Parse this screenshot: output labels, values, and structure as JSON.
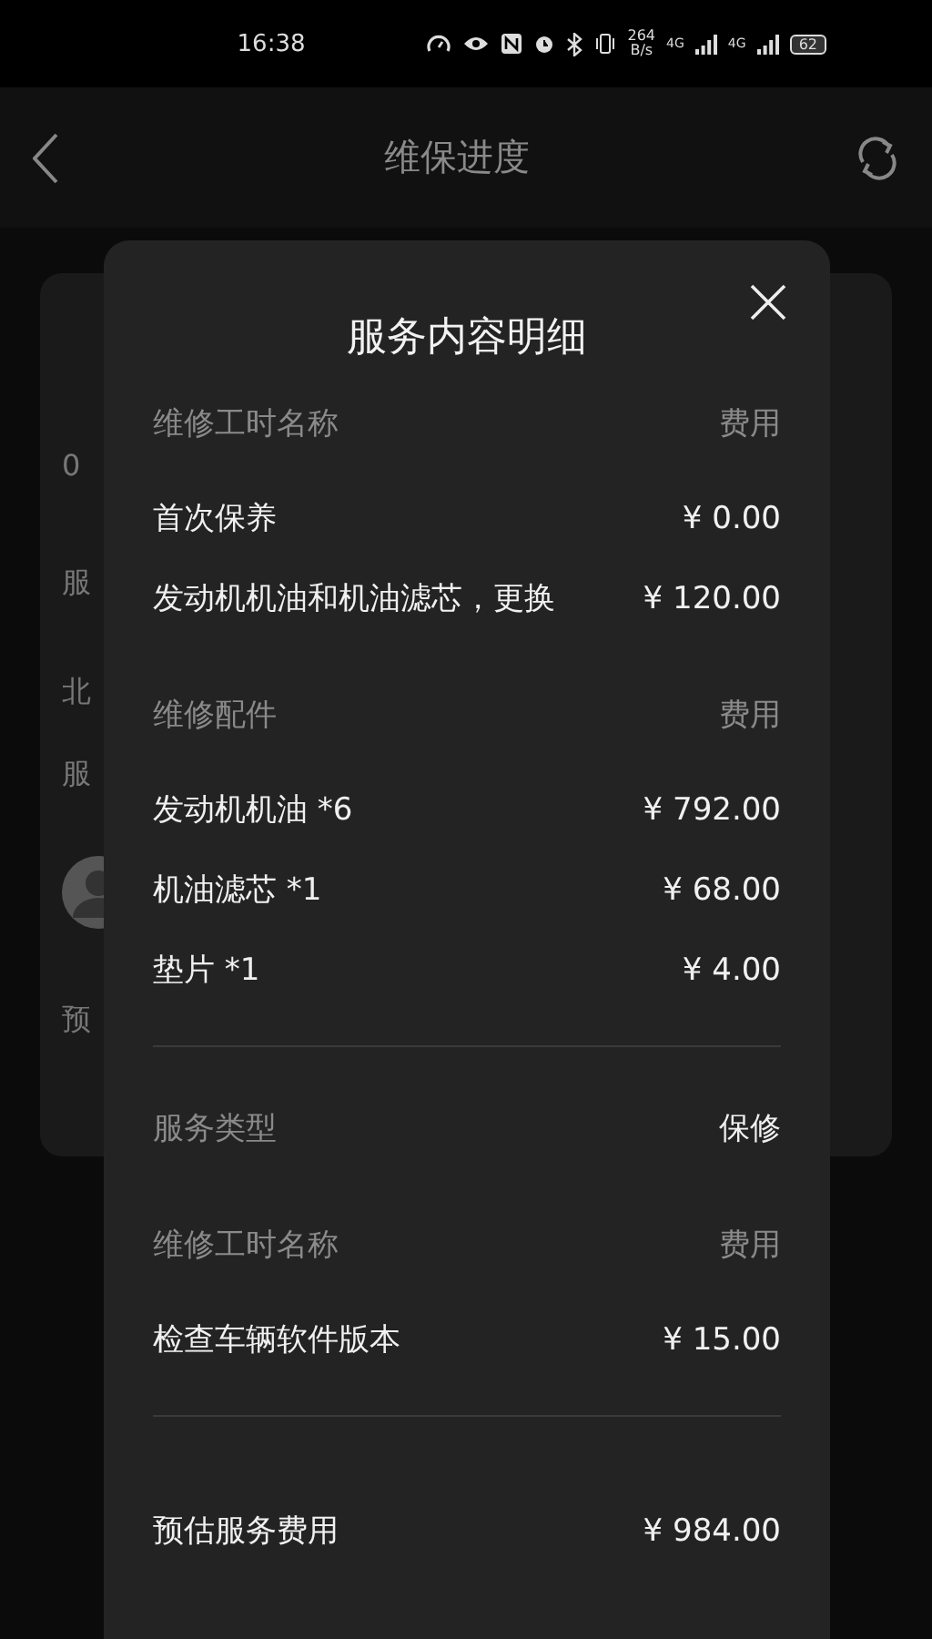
{
  "status_bar": {
    "time": "16:38",
    "speed": "264",
    "speed_unit": "B/s",
    "networks": [
      "4G",
      "4G"
    ],
    "battery": "62"
  },
  "header": {
    "title": "维保进度"
  },
  "background_card": {
    "texts": [
      "0",
      "服",
      "北",
      "服",
      "预"
    ]
  },
  "dialog": {
    "title": "服务内容明细",
    "sections": [
      {
        "kind": "table",
        "name_header": "维修工时名称",
        "fee_header": "费用",
        "items": [
          {
            "name": "首次保养",
            "fee": "¥ 0.00"
          },
          {
            "name": "发动机机油和机油滤芯，更换",
            "fee": "¥ 120.00"
          }
        ]
      },
      {
        "kind": "table",
        "name_header": "维修配件",
        "fee_header": "费用",
        "items": [
          {
            "name": "发动机机油 *6",
            "fee": "¥ 792.00"
          },
          {
            "name": "机油滤芯 *1",
            "fee": "¥ 68.00"
          },
          {
            "name": "垫片 *1",
            "fee": "¥ 4.00"
          }
        ]
      },
      {
        "kind": "pair",
        "label": "服务类型",
        "value": "保修"
      },
      {
        "kind": "table",
        "name_header": "维修工时名称",
        "fee_header": "费用",
        "items": [
          {
            "name": "检查车辆软件版本",
            "fee": "¥ 15.00"
          }
        ]
      },
      {
        "kind": "total",
        "label": "预估服务费用",
        "value": "¥ 984.00"
      }
    ]
  }
}
